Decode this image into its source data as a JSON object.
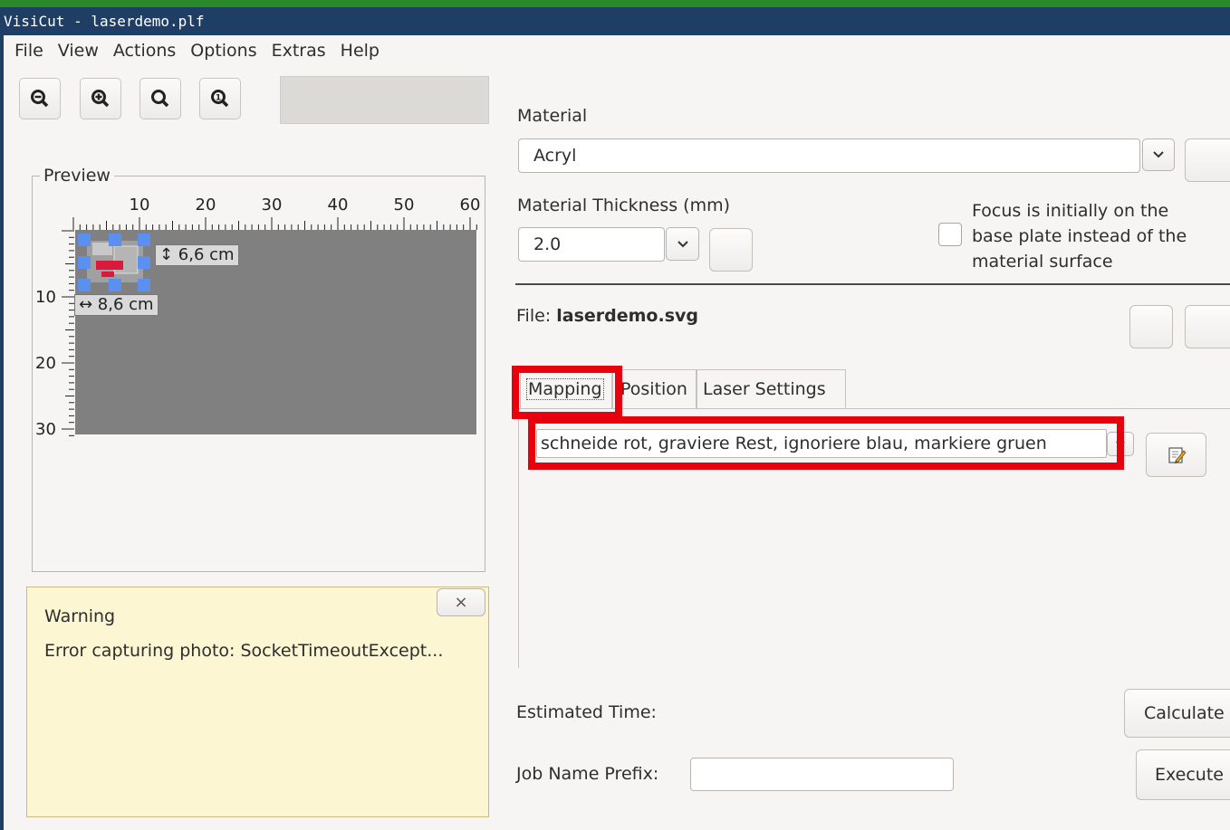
{
  "window": {
    "title": "VisiCut - laserdemo.plf"
  },
  "menu": [
    "File",
    "View",
    "Actions",
    "Options",
    "Extras",
    "Help"
  ],
  "toolbar": {
    "zoom_out": "zoom-out-icon",
    "zoom_in": "zoom-in-icon",
    "zoom_fit": "zoom-fit-icon",
    "zoom_reset": "zoom-1to1-icon"
  },
  "preview": {
    "title": "Preview",
    "unit": "cm",
    "top_ticks": [
      "10",
      "20",
      "30",
      "40",
      "50",
      "60"
    ],
    "left_ticks": [
      "10",
      "20",
      "30"
    ],
    "height_label": "↕ 6,6 cm",
    "width_label": "↔ 8,6 cm"
  },
  "warning": {
    "title": "Warning",
    "message": "Error capturing photo: SocketTimeoutExcept...",
    "close_label": "×"
  },
  "material": {
    "label": "Material",
    "value": "Acryl",
    "thickness_label": "Material Thickness (mm)",
    "thickness_value": "2.0",
    "focus_line1": "Focus is initially on the",
    "focus_line2": "base plate instead of the",
    "focus_line3": "material surface",
    "focus_checked": false
  },
  "file": {
    "label": "File: ",
    "name": "laserdemo.svg"
  },
  "tabs": [
    "Mapping",
    "Position",
    "Laser Settings"
  ],
  "mapping": {
    "value": "schneide rot, graviere Rest, ignoriere blau, markiere gruen"
  },
  "footer": {
    "estimated_time_label": "Estimated Time:",
    "calculate_label": "Calculate",
    "job_prefix_label": "Job Name Prefix:",
    "job_prefix_value": "",
    "execute_label": "Execute"
  },
  "colors": {
    "highlight": "#e8000d",
    "titlebar": "#1f3e66",
    "warning_bg": "#fcf6d2",
    "canvas": "#808080"
  }
}
